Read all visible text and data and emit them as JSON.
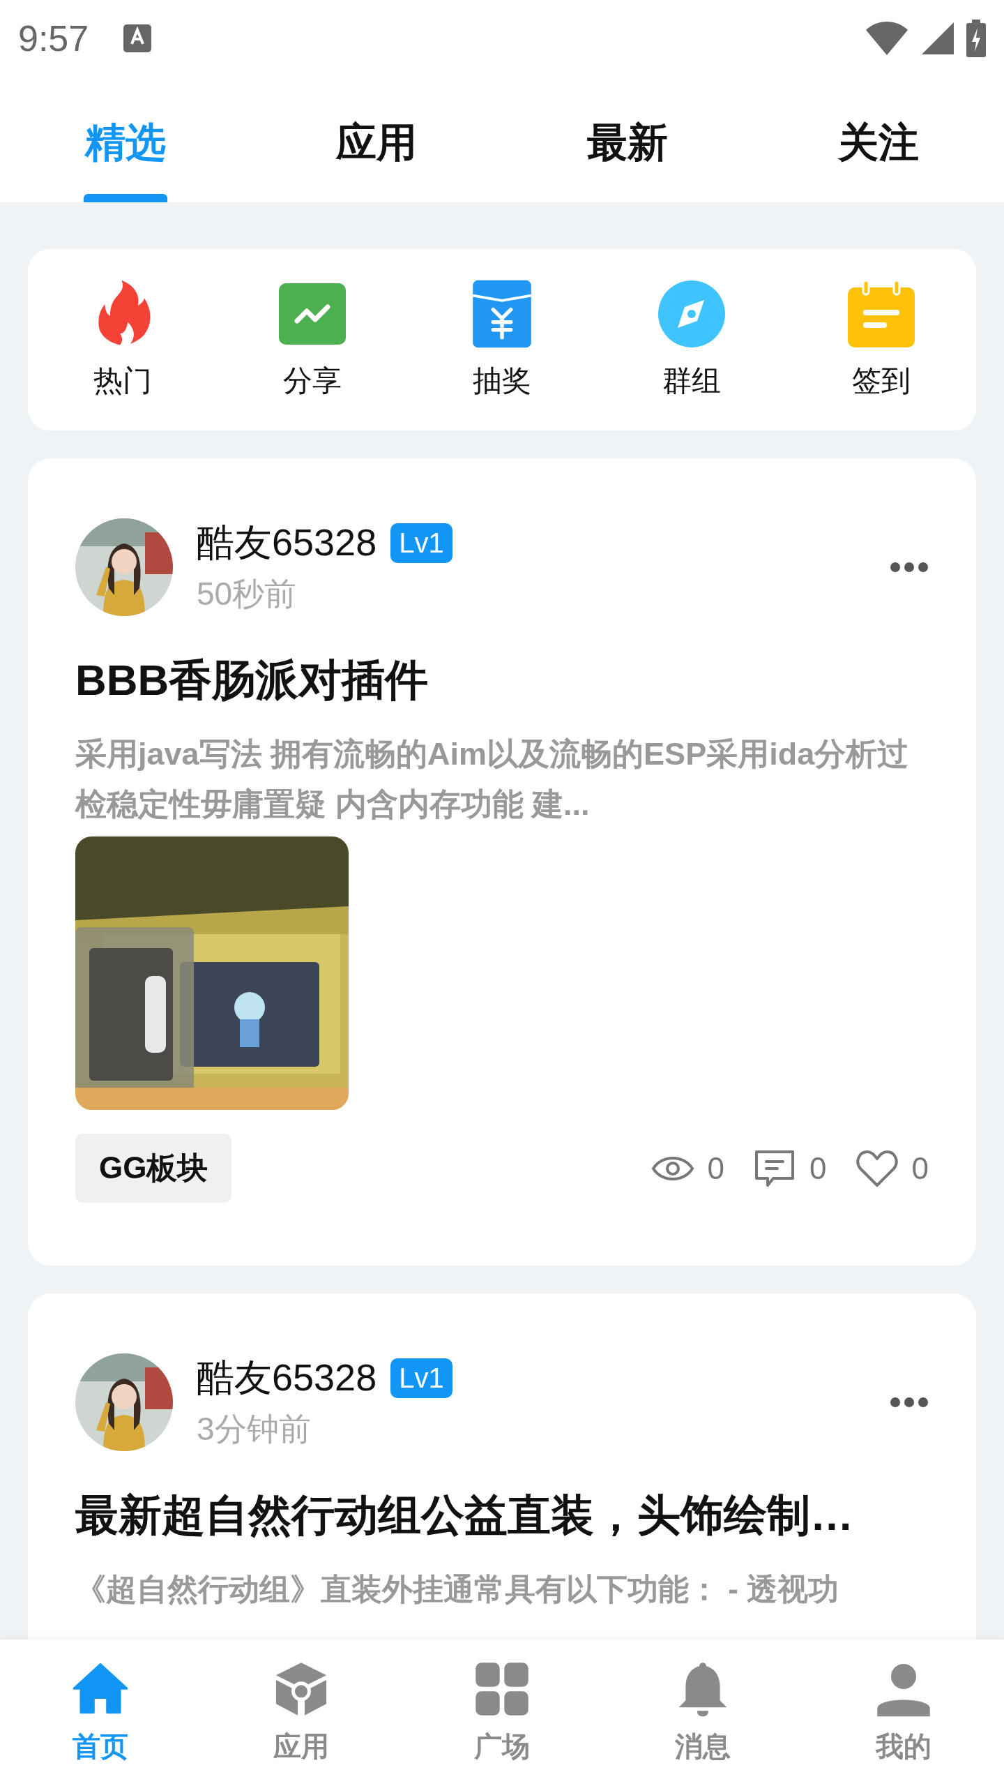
{
  "status_bar": {
    "time": "9:57"
  },
  "tabs": [
    {
      "label": "精选",
      "selected": true
    },
    {
      "label": "应用",
      "selected": false
    },
    {
      "label": "最新",
      "selected": false
    },
    {
      "label": "关注",
      "selected": false
    }
  ],
  "shortcuts": [
    {
      "label": "热门",
      "kind": "flame"
    },
    {
      "label": "分享",
      "kind": "chart"
    },
    {
      "label": "抽奖",
      "kind": "envelope"
    },
    {
      "label": "群组",
      "kind": "compass"
    },
    {
      "label": "签到",
      "kind": "calendar"
    }
  ],
  "posts": [
    {
      "author": "酷友65328",
      "level_badge": "Lv1",
      "time": "50秒前",
      "title": "BBB香肠派对插件",
      "excerpt": "采用java写法 拥有流畅的Aim以及流畅的ESP采用ida分析过检稳定性毋庸置疑 内含内存功能 建...",
      "tag": "GG板块",
      "views": "0",
      "comments": "0",
      "likes": "0"
    },
    {
      "author": "酷友65328",
      "level_badge": "Lv1",
      "time": "3分钟前",
      "title": "最新超自然行动组公益直装，头饰绘制…",
      "excerpt": "《超自然行动组》直装外挂通常具有以下功能： - 透视功"
    }
  ],
  "bottom_nav": [
    {
      "label": "首页",
      "kind": "home",
      "selected": true
    },
    {
      "label": "应用",
      "kind": "cube",
      "selected": false
    },
    {
      "label": "广场",
      "kind": "grid",
      "selected": false
    },
    {
      "label": "消息",
      "kind": "bell",
      "selected": false
    },
    {
      "label": "我的",
      "kind": "person",
      "selected": false
    }
  ]
}
